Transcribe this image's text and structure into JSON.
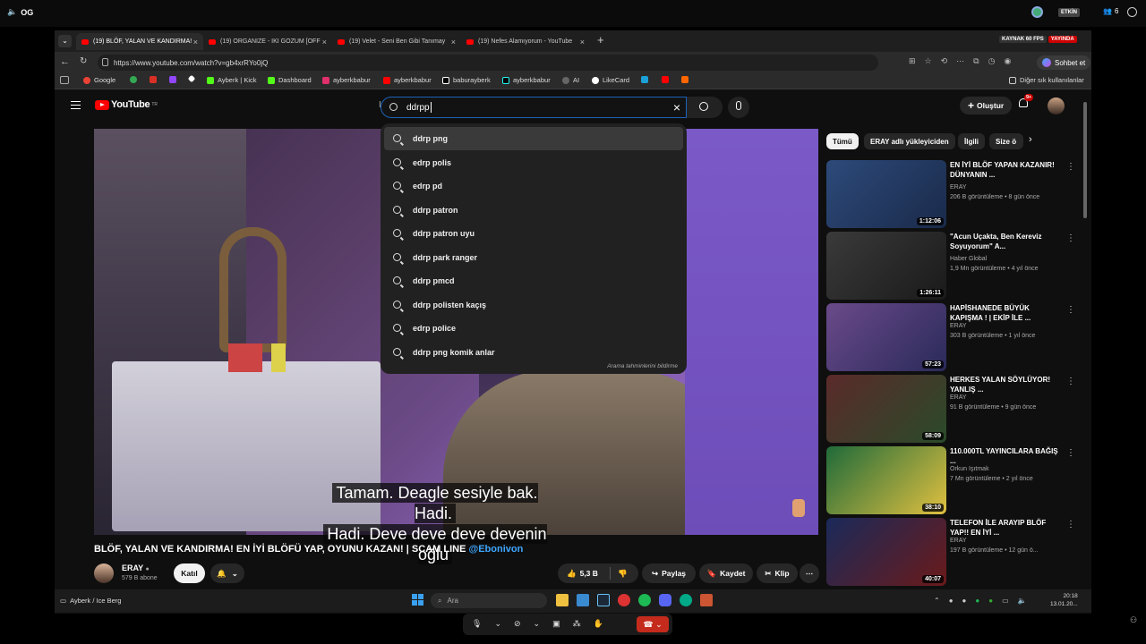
{
  "top": {
    "app_label": "OG",
    "badge_etkin": "ETKİN",
    "people_count": "6"
  },
  "tabs": [
    {
      "label": "(19) BLÖF, YALAN VE KANDIRMA!"
    },
    {
      "label": "(19) ORGANIZE - IKI GOZUM [OFF"
    },
    {
      "label": "(19) Velet - Seni Ben Gibi Tanımay"
    },
    {
      "label": "(19) Nefes Alamıyorum - YouTube"
    }
  ],
  "stream": {
    "fps_label": "KAYNAK 60 FPS",
    "live_label": "YAYINDA"
  },
  "address": {
    "url": "https://www.youtube.com/watch?v=gb4xrRYo0jQ",
    "chat_label": "Sohbet et"
  },
  "bookmarks": [
    {
      "label": "Google",
      "color": "#ea4335"
    },
    {
      "label": "",
      "color": "#34a853"
    },
    {
      "label": "",
      "color": "#d93025"
    },
    {
      "label": "",
      "color": "#9146ff"
    },
    {
      "label": "",
      "color": "#ffffff"
    },
    {
      "label": "Ayberk | Kick",
      "color": "#53fc18"
    },
    {
      "label": "Dashboard",
      "color": "#53fc18"
    },
    {
      "label": "ayberkbabur",
      "color": "#e1306c"
    },
    {
      "label": "ayberkbabur",
      "color": "#ff0000"
    },
    {
      "label": "baburayberk",
      "color": "#ffffff"
    },
    {
      "label": "ayberkbabur",
      "color": "#ffffff"
    },
    {
      "label": "AI",
      "color": "#aaaaaa"
    },
    {
      "label": "LikeCard",
      "color": "#ffffff"
    }
  ],
  "bookmarks_other": "Diğer sık kullanılanlar",
  "youtube": {
    "logo_text": "YouTube",
    "logo_sup": "TR",
    "search_value": "ddrpp",
    "create_label": "Oluştur",
    "notif_count": "9+"
  },
  "suggestions": [
    "ddrp png",
    "edrp polis",
    "edrp pd",
    "ddrp patron",
    "ddrp patron uyu",
    "ddrp park ranger",
    "ddrp pmcd",
    "ddrp polisten kaçış",
    "edrp police",
    "ddrp png komik anlar"
  ],
  "suggestions_report": "Arama tahminlerini bildirme",
  "video": {
    "caption_line1": "Tamam. Deagle sesiyle bak. Hadi.",
    "caption_line2": "Hadi. Deve deve deve devenin oğlu",
    "title": "BLÖF, YALAN VE KANDIRMA! EN İYİ BLÖFÜ YAP, OYUNU KAZAN! | SCAM LINE",
    "title_mention": "@Ebonivon",
    "channel": "ERAY",
    "subs": "579 B abone",
    "join_label": "Katıl",
    "likes": "5,3 B",
    "share_label": "Paylaş",
    "save_label": "Kaydet",
    "clip_label": "Klip"
  },
  "chips": [
    "Tümü",
    "ERAY adlı yükleyiciden",
    "İlgili",
    "Size ö"
  ],
  "recommendations": [
    {
      "title": "EN İYİ BLÖF YAPAN KAZANIR! DÜNYANIN ...",
      "channel": "ERAY",
      "meta": "206 B görüntüleme • 8 gün önce",
      "duration": "1:12:06",
      "color": "#2d4a7a"
    },
    {
      "title": "\"Acun Uçakta, Ben Kereviz Soyuyorum\" A...",
      "channel": "Haber Global",
      "meta": "1,9 Mn görüntüleme • 4 yıl önce",
      "duration": "1:26:11",
      "color": "#3a3a3a"
    },
    {
      "title": "HAPİSHANEDE BÜYÜK KAPIŞMA ! | EKİP İLE ...",
      "channel": "ERAY",
      "meta": "303 B görüntüleme • 1 yıl önce",
      "duration": "57:23",
      "color": "#6a4a8a"
    },
    {
      "title": "HERKES YALAN SÖYLÜYOR! YANLIŞ ...",
      "channel": "ERAY",
      "meta": "91 B görüntüleme • 9 gün önce",
      "duration": "58:09",
      "color": "#5a2a2a"
    },
    {
      "title": "110.000TL YAYINCILARA BAĞIŞ ...",
      "channel": "Orkun Işıtmak",
      "meta": "7 Mn görüntüleme • 2 yıl önce",
      "duration": "38:10",
      "color": "#1f6a3a"
    },
    {
      "title": "TELEFON İLE ARAYIP BLÖF YAP!! EN İYİ ...",
      "channel": "ERAY",
      "meta": "197 B görüntüleme • 12 gün ö...",
      "duration": "40:07",
      "color": "#1a2a5a"
    }
  ],
  "taskbar": {
    "window_label": "Ayberk / Ice Berg",
    "search_placeholder": "Ara",
    "clock_time": "20:18",
    "clock_date": "13.01.20..."
  }
}
